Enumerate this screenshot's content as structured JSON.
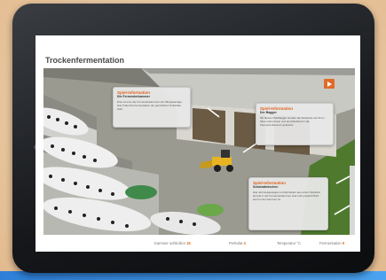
{
  "page_title": "Trockenfermentation",
  "popups": [
    {
      "heading": "Spiel-Information",
      "subheading": "Die Fermenterkammer",
      "body": "Dies ist eine der Fermenterkammern der Biogasanlage. Hier findet die Fermentation der gemischten Substrate statt."
    },
    {
      "heading": "Spiel-Information",
      "subheading": "Der Bagger",
      "body": "Mit diesem Radbagger werden die Substrate aus ihren Silos entnommen und anschließend in die Fermenterkammer gebracht."
    },
    {
      "heading": "Spiel-Information",
      "subheading": "Substratmischen",
      "body": "Hier wird ausgewogen und Einheiten aus einem Substrat korrekt in der Fermenterkammer sind und entsteht Platz auch in der Kammer ist."
    }
  ],
  "controls": {
    "kammer_label": "Kammer schließen",
    "kammer_value": "18",
    "perkolat_label": "Perkolat",
    "perkolat_value": "4",
    "temperatur_label": "Temperatur °C",
    "fermentation_label": "Fermentation",
    "fermentation_value": "9"
  },
  "colors": {
    "accent": "#e0601a",
    "brand_blue": "#2d7fd8"
  }
}
